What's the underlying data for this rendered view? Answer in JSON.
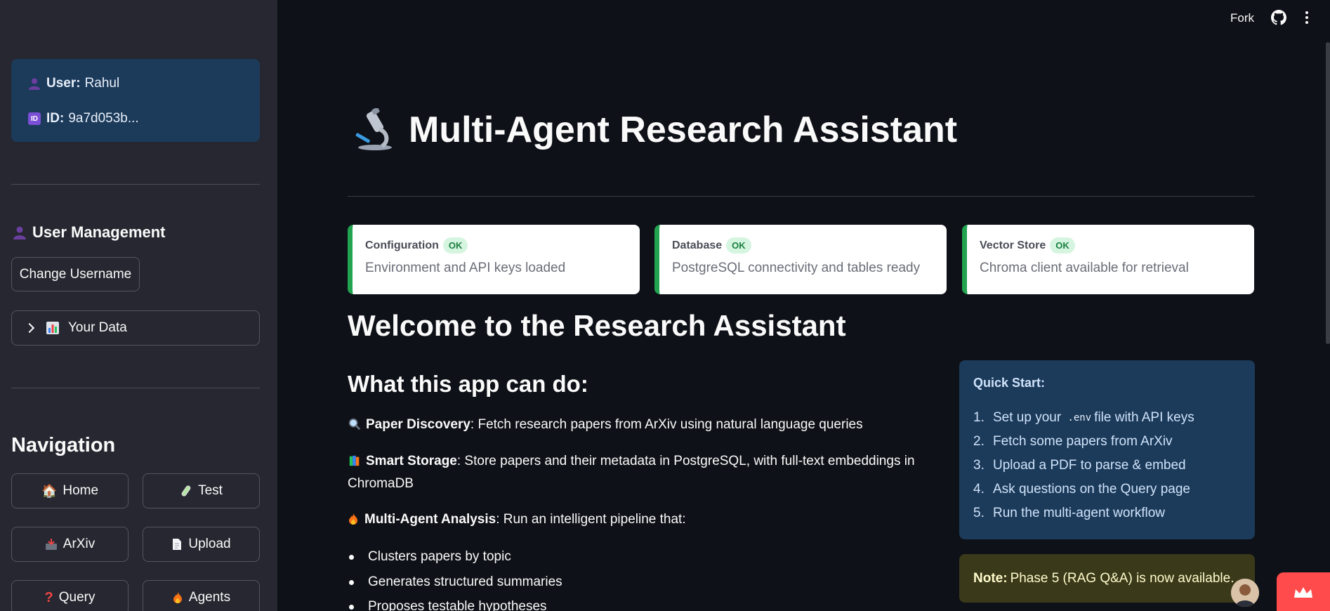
{
  "sidebar": {
    "user_label": "User:",
    "user_name": "Rahul",
    "id_label": "ID:",
    "id_value": "9a7d053b...",
    "id_badge": "ID",
    "user_management_title": "User Management",
    "change_username_label": "Change Username",
    "your_data_label": "Your Data",
    "navigation_title": "Navigation",
    "nav": [
      {
        "label": "Home",
        "icon": "house-icon"
      },
      {
        "label": "Test",
        "icon": "test-tube-icon"
      },
      {
        "label": "ArXiv",
        "icon": "inbox-tray-icon"
      },
      {
        "label": "Upload",
        "icon": "page-icon"
      },
      {
        "label": "Query",
        "icon": "question-icon"
      },
      {
        "label": "Agents",
        "icon": "fire-icon"
      }
    ]
  },
  "topbar": {
    "fork_label": "Fork"
  },
  "main": {
    "title": "Multi-Agent Research Assistant",
    "status_cards": [
      {
        "name": "Configuration",
        "status": "OK",
        "description": "Environment and API keys loaded"
      },
      {
        "name": "Database",
        "status": "OK",
        "description": "PostgreSQL connectivity and tables ready"
      },
      {
        "name": "Vector Store",
        "status": "OK",
        "description": "Chroma client available for retrieval"
      }
    ],
    "welcome": "Welcome to the Research Assistant",
    "can_do_title": "What this app can do:",
    "features": [
      {
        "title": "Paper Discovery",
        "text": ": Fetch research papers from ArXiv using natural language queries"
      },
      {
        "title": "Smart Storage",
        "text": ": Store papers and their metadata in PostgreSQL, with full-text embeddings in ChromaDB"
      },
      {
        "title": "Multi-Agent Analysis",
        "text": ": Run an intelligent pipeline that:"
      }
    ],
    "bullets": [
      "Clusters papers by topic",
      "Generates structured summaries",
      "Proposes testable hypotheses"
    ],
    "quick_start": {
      "title": "Quick Start:",
      "step1_pre": "Set up your",
      "step1_code": ".env",
      "step1_post": "file with API keys",
      "steps": [
        "Fetch some papers from ArXiv",
        "Upload a PDF to parse & embed",
        "Ask questions on the Query page",
        "Run the multi-agent workflow"
      ]
    },
    "note_label": "Note:",
    "note_text": "Phase 5 (RAG Q&A) is now available."
  },
  "colors": {
    "accent_green": "#21a350",
    "info_blue": "#1c3a5a",
    "warning_yellow": "#3a3a1a",
    "streamlit_red": "#ff4b4b"
  }
}
